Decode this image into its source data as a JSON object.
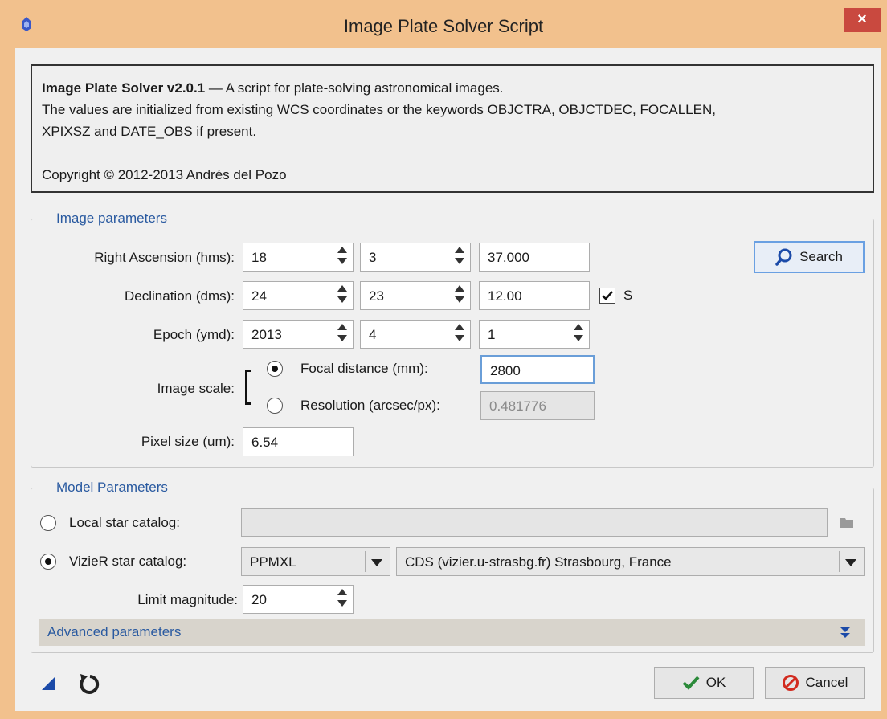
{
  "window": {
    "title": "Image Plate Solver Script",
    "close_glyph": "×",
    "accent": "#f2c18d"
  },
  "info": {
    "heading": "Image Plate Solver v2.0.1",
    "heading_rest": " — A script for plate-solving astronomical images.",
    "line2": "The values are initialized from existing WCS coordinates or the keywords OBJCTRA, OBJCTDEC, FOCALLEN,",
    "line3": "XPIXSZ and DATE_OBS if present.",
    "copyright": "Copyright © 2012-2013 Andrés del Pozo"
  },
  "image_params": {
    "legend": "Image parameters",
    "ra": {
      "label": "Right Ascension (hms):",
      "h": "18",
      "m": "3",
      "s": "37.000"
    },
    "dec": {
      "label": "Declination (dms):",
      "d": "24",
      "m": "23",
      "s": "12.00",
      "south_label": "S",
      "south_checked": true
    },
    "epoch": {
      "label": "Epoch (ymd):",
      "y": "2013",
      "m": "4",
      "d": "1"
    },
    "scale": {
      "label": "Image scale:",
      "focal_label": "Focal distance (mm):",
      "focal_value": "2800",
      "focal_selected": true,
      "res_label": "Resolution (arcsec/px):",
      "res_value": "0.481776"
    },
    "pixel": {
      "label": "Pixel size (um):",
      "value": "6.54"
    },
    "search_label": "Search"
  },
  "model_params": {
    "legend": "Model Parameters",
    "local_label": "Local star catalog:",
    "local_value": "",
    "vizier_label": "VizieR star catalog:",
    "vizier_selected": true,
    "catalog": "PPMXL",
    "server": "CDS (vizier.u-strasbg.fr) Strasbourg, France",
    "limit_label": "Limit magnitude:",
    "limit_value": "20",
    "advanced_label": "Advanced parameters"
  },
  "footer": {
    "ok_label": "OK",
    "cancel_label": "Cancel"
  },
  "icons": [
    "app-icon",
    "close-icon",
    "search-icon",
    "folder-icon",
    "expand-icon",
    "new-instance-icon",
    "reset-icon",
    "checkmark-icon",
    "cancel-icon"
  ]
}
